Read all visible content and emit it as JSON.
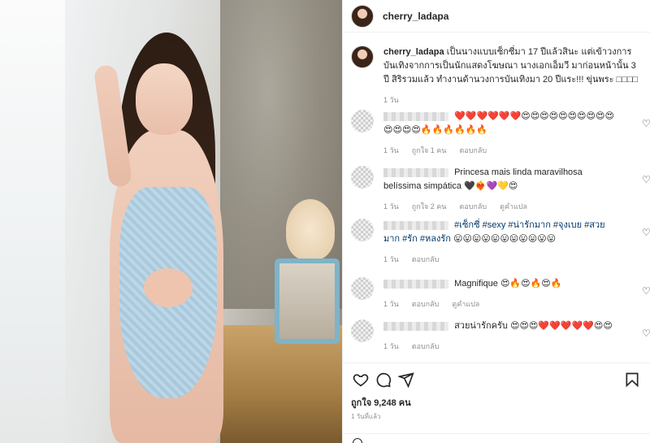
{
  "post": {
    "username": "cherry_ladapa"
  },
  "caption": {
    "username": "cherry_ladapa",
    "text": "เป็นนางแบบเซ็กซี่มา 17 ปีแล้วสินะ แต่เข้าวงการบันเทิงจากการเป็นนักแสดงโฆษณา นางเอกเอ็มวี มาก่อนหน้านั้น 3 ปี สิริรวมแล้ว ทำงานด้านวงการบันเทิงมา 20 ปีแระ!!! ขุ่นพระ □□□□",
    "time": "1 วัน"
  },
  "comments": [
    {
      "text": "❤️❤️❤️❤️❤️❤️😍😍😍😍😍😍😍😍😍😍😍😍😍😍🔥🔥🔥🔥🔥🔥",
      "time": "1 วัน",
      "likes": "ถูกใจ 1 คน",
      "reply": "ตอบกลับ"
    },
    {
      "name_suffix": "Princesa mais linda maravilhosa belíssima simpática",
      "text": "🖤❤️‍🔥💜💛😍",
      "time": "1 วัน",
      "likes": "ถูกใจ 2 คน",
      "reply": "ตอบกลับ",
      "translate": "ดูคำแปล"
    },
    {
      "tags": "#เซ็กซี่ #sexy #น่ารักมาก #จุงเบย #สวยมาก #รัก #หลงรัก",
      "text": "😛😛😛😛😛😛😛😛😛😛😛",
      "time": "1 วัน",
      "reply": "ตอบกลับ"
    },
    {
      "name_suffix": "Magnifique",
      "text": "😍🔥😍🔥😍🔥",
      "time": "1 วัน",
      "reply": "ตอบกลับ",
      "translate": "ดูคำแปล"
    },
    {
      "name_suffix": "สวยน่ารักครับ",
      "text": "😍😍😍❤️❤️❤️❤️❤️😍😍",
      "time": "1 วัน",
      "reply": "ตอบกลับ"
    }
  ],
  "footer": {
    "likes": "ถูกใจ 9,248 คน",
    "timestamp": "1 วันที่แล้ว"
  },
  "icons": {
    "like": "heart-icon",
    "comment": "comment-icon",
    "share": "send-icon",
    "save": "bookmark-icon"
  }
}
